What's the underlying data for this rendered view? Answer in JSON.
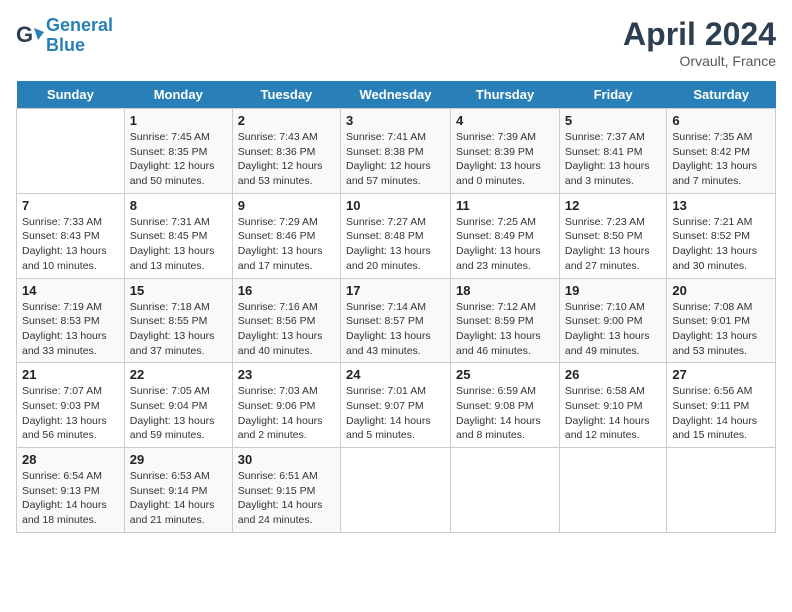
{
  "header": {
    "logo_line1": "General",
    "logo_line2": "Blue",
    "month_title": "April 2024",
    "location": "Orvault, France"
  },
  "weekdays": [
    "Sunday",
    "Monday",
    "Tuesday",
    "Wednesday",
    "Thursday",
    "Friday",
    "Saturday"
  ],
  "weeks": [
    [
      {
        "day": "",
        "info": ""
      },
      {
        "day": "1",
        "info": "Sunrise: 7:45 AM\nSunset: 8:35 PM\nDaylight: 12 hours\nand 50 minutes."
      },
      {
        "day": "2",
        "info": "Sunrise: 7:43 AM\nSunset: 8:36 PM\nDaylight: 12 hours\nand 53 minutes."
      },
      {
        "day": "3",
        "info": "Sunrise: 7:41 AM\nSunset: 8:38 PM\nDaylight: 12 hours\nand 57 minutes."
      },
      {
        "day": "4",
        "info": "Sunrise: 7:39 AM\nSunset: 8:39 PM\nDaylight: 13 hours\nand 0 minutes."
      },
      {
        "day": "5",
        "info": "Sunrise: 7:37 AM\nSunset: 8:41 PM\nDaylight: 13 hours\nand 3 minutes."
      },
      {
        "day": "6",
        "info": "Sunrise: 7:35 AM\nSunset: 8:42 PM\nDaylight: 13 hours\nand 7 minutes."
      }
    ],
    [
      {
        "day": "7",
        "info": "Sunrise: 7:33 AM\nSunset: 8:43 PM\nDaylight: 13 hours\nand 10 minutes."
      },
      {
        "day": "8",
        "info": "Sunrise: 7:31 AM\nSunset: 8:45 PM\nDaylight: 13 hours\nand 13 minutes."
      },
      {
        "day": "9",
        "info": "Sunrise: 7:29 AM\nSunset: 8:46 PM\nDaylight: 13 hours\nand 17 minutes."
      },
      {
        "day": "10",
        "info": "Sunrise: 7:27 AM\nSunset: 8:48 PM\nDaylight: 13 hours\nand 20 minutes."
      },
      {
        "day": "11",
        "info": "Sunrise: 7:25 AM\nSunset: 8:49 PM\nDaylight: 13 hours\nand 23 minutes."
      },
      {
        "day": "12",
        "info": "Sunrise: 7:23 AM\nSunset: 8:50 PM\nDaylight: 13 hours\nand 27 minutes."
      },
      {
        "day": "13",
        "info": "Sunrise: 7:21 AM\nSunset: 8:52 PM\nDaylight: 13 hours\nand 30 minutes."
      }
    ],
    [
      {
        "day": "14",
        "info": "Sunrise: 7:19 AM\nSunset: 8:53 PM\nDaylight: 13 hours\nand 33 minutes."
      },
      {
        "day": "15",
        "info": "Sunrise: 7:18 AM\nSunset: 8:55 PM\nDaylight: 13 hours\nand 37 minutes."
      },
      {
        "day": "16",
        "info": "Sunrise: 7:16 AM\nSunset: 8:56 PM\nDaylight: 13 hours\nand 40 minutes."
      },
      {
        "day": "17",
        "info": "Sunrise: 7:14 AM\nSunset: 8:57 PM\nDaylight: 13 hours\nand 43 minutes."
      },
      {
        "day": "18",
        "info": "Sunrise: 7:12 AM\nSunset: 8:59 PM\nDaylight: 13 hours\nand 46 minutes."
      },
      {
        "day": "19",
        "info": "Sunrise: 7:10 AM\nSunset: 9:00 PM\nDaylight: 13 hours\nand 49 minutes."
      },
      {
        "day": "20",
        "info": "Sunrise: 7:08 AM\nSunset: 9:01 PM\nDaylight: 13 hours\nand 53 minutes."
      }
    ],
    [
      {
        "day": "21",
        "info": "Sunrise: 7:07 AM\nSunset: 9:03 PM\nDaylight: 13 hours\nand 56 minutes."
      },
      {
        "day": "22",
        "info": "Sunrise: 7:05 AM\nSunset: 9:04 PM\nDaylight: 13 hours\nand 59 minutes."
      },
      {
        "day": "23",
        "info": "Sunrise: 7:03 AM\nSunset: 9:06 PM\nDaylight: 14 hours\nand 2 minutes."
      },
      {
        "day": "24",
        "info": "Sunrise: 7:01 AM\nSunset: 9:07 PM\nDaylight: 14 hours\nand 5 minutes."
      },
      {
        "day": "25",
        "info": "Sunrise: 6:59 AM\nSunset: 9:08 PM\nDaylight: 14 hours\nand 8 minutes."
      },
      {
        "day": "26",
        "info": "Sunrise: 6:58 AM\nSunset: 9:10 PM\nDaylight: 14 hours\nand 12 minutes."
      },
      {
        "day": "27",
        "info": "Sunrise: 6:56 AM\nSunset: 9:11 PM\nDaylight: 14 hours\nand 15 minutes."
      }
    ],
    [
      {
        "day": "28",
        "info": "Sunrise: 6:54 AM\nSunset: 9:13 PM\nDaylight: 14 hours\nand 18 minutes."
      },
      {
        "day": "29",
        "info": "Sunrise: 6:53 AM\nSunset: 9:14 PM\nDaylight: 14 hours\nand 21 minutes."
      },
      {
        "day": "30",
        "info": "Sunrise: 6:51 AM\nSunset: 9:15 PM\nDaylight: 14 hours\nand 24 minutes."
      },
      {
        "day": "",
        "info": ""
      },
      {
        "day": "",
        "info": ""
      },
      {
        "day": "",
        "info": ""
      },
      {
        "day": "",
        "info": ""
      }
    ]
  ]
}
